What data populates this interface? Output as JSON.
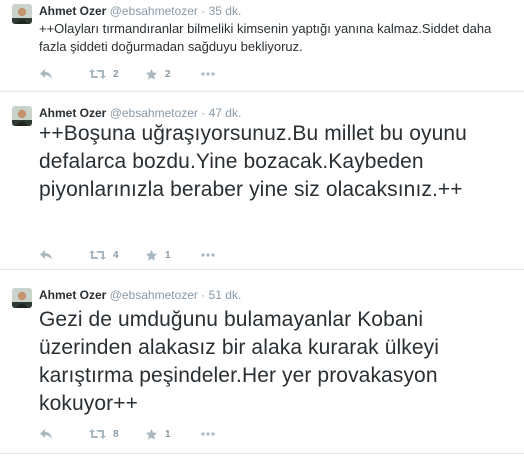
{
  "tweets": [
    {
      "name": "Ahmet Ozer",
      "handle": "@ebsahmetozer",
      "separator": "·",
      "time": "35 dk.",
      "text": "++Olayları tırmandıranlar bilmeliki kimsenin yaptığı yanına kalmaz.Siddet daha fazla şiddeti doğurmadan  sağduyu bekliyoruz.",
      "retweets": "2",
      "favorites": "2"
    },
    {
      "name": "Ahmet Ozer",
      "handle": "@ebsahmetozer",
      "separator": "·",
      "time": "47 dk.",
      "text": "++Boşuna uğraşıyorsunuz.Bu millet bu oyunu defalarca bozdu.Yine bozacak.Kaybeden piyonlarınızla beraber yine siz olacaksınız.++",
      "retweets": "4",
      "favorites": "1"
    },
    {
      "name": "Ahmet Ozer",
      "handle": "@ebsahmetozer",
      "separator": "·",
      "time": "51 dk.",
      "text": "Gezi de umduğunu bulamayanlar Kobani üzerinden alakasız bir alaka kurarak ülkeyi karıştırma peşindeler.Her yer provakasyon kokuyor++",
      "retweets": "8",
      "favorites": "1"
    }
  ],
  "icons": {
    "reply": "reply-arrow-icon",
    "retweet": "retweet-icon",
    "favorite": "star-icon",
    "more": "more-dots-icon"
  },
  "colors": {
    "text": "#292f33",
    "meta": "#8899a6",
    "icon": "#aab8c2",
    "divider": "#e1e8ed"
  }
}
